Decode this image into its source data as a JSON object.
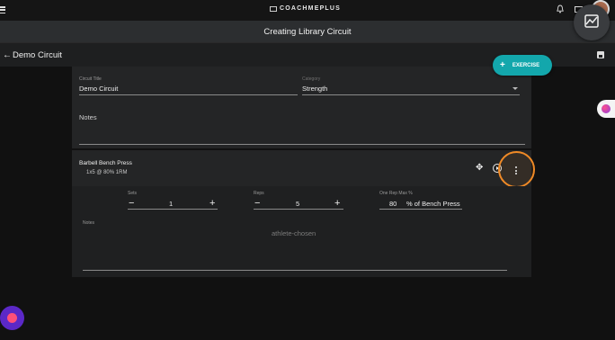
{
  "topbar": {
    "brand": "COACHMEPLUS",
    "icons": [
      "menu-icon",
      "bell-icon",
      "mail-icon",
      "avatar"
    ]
  },
  "page_header": {
    "title": "Creating Library Circuit"
  },
  "subheader": {
    "circuit_name": "Demo Circuit",
    "icons": [
      "back-arrow-icon",
      "save-icon"
    ]
  },
  "add_exercise": {
    "label": "EXERCISE",
    "icon": "plus-icon"
  },
  "circuit_form": {
    "title_label": "Circuit Title",
    "title_value": "Demo Circuit",
    "category_label": "Category",
    "category_value": "Strength",
    "notes_placeholder": "Notes"
  },
  "exercise": {
    "name": "Barbell Bench Press",
    "summary": "1x5  @ 80% 1RM",
    "sets_label": "Sets",
    "sets_value": "1",
    "reps_label": "Reps",
    "reps_value": "5",
    "orm_label": "One Rep Max %",
    "orm_value": "80",
    "orm_suffix": "% of Bench Press",
    "notes_label": "Notes",
    "notes_value": "athlete-chosen",
    "minus": "−",
    "plus": "+"
  },
  "colors": {
    "accent_teal": "#13a7ac",
    "highlight_orange": "#f08a26",
    "fab_purple": "#5b28c7"
  }
}
